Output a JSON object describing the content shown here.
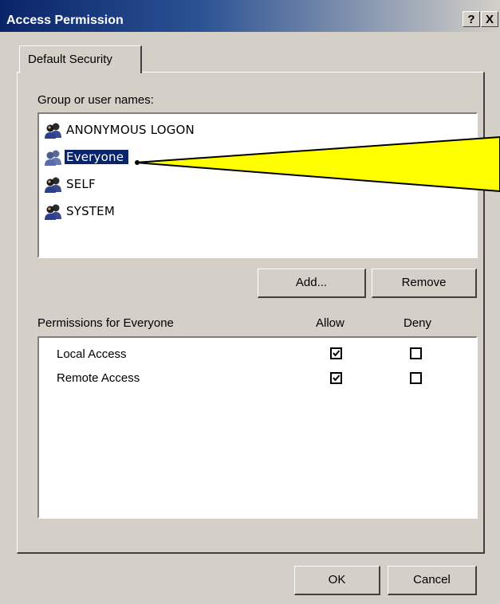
{
  "window": {
    "title": "Access Permission",
    "help_btn": "?",
    "close_btn": "X"
  },
  "tabs": [
    {
      "label": "Default Security"
    }
  ],
  "groups": {
    "label": "Group or user names:",
    "items": [
      {
        "name": "ANONYMOUS LOGON",
        "icon": "users-icon",
        "selected": false
      },
      {
        "name": "Everyone",
        "icon": "users-icon",
        "selected": true
      },
      {
        "name": "SELF",
        "icon": "users-icon",
        "selected": false
      },
      {
        "name": "SYSTEM",
        "icon": "users-icon",
        "selected": false
      }
    ]
  },
  "buttons": {
    "add": "Add...",
    "remove": "Remove",
    "ok": "OK",
    "cancel": "Cancel"
  },
  "permissions": {
    "header": "Permissions for Everyone",
    "allow_header": "Allow",
    "deny_header": "Deny",
    "rows": [
      {
        "name": "Local Access",
        "allow": true,
        "deny": false
      },
      {
        "name": "Remote Access",
        "allow": true,
        "deny": false
      }
    ]
  },
  "colors": {
    "selection": "#0a246a",
    "callout": "#ffff00",
    "dialog": "#d4d0c8"
  }
}
